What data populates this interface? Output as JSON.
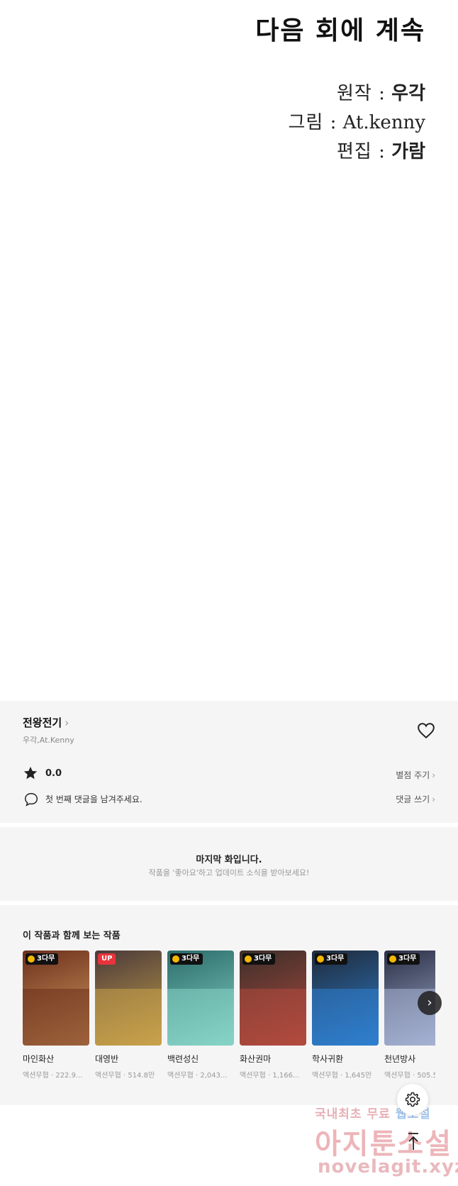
{
  "panel": {
    "next_text": "다음 회에 계속",
    "credits": [
      {
        "label": "원작 :",
        "value": "우각"
      },
      {
        "label": "그림 :",
        "value": "At.kenny"
      },
      {
        "label": "편집 :",
        "value": "가람"
      }
    ]
  },
  "episode": {
    "series_title": "전왕전기",
    "authors": "우각,At.Kenny",
    "rating": "0.0",
    "rate_link": "별점 주기",
    "comment_prompt": "첫 번째 댓글을 남겨주세요.",
    "comment_link": "댓글 쓰기"
  },
  "notice": {
    "title": "마지막 화입니다.",
    "subtitle": "작품을 '좋아요'하고 업데이트 소식을 받아보세요!"
  },
  "recommendations": {
    "title": "이 작품과 함께 보는 작품",
    "items": [
      {
        "title": "마인화산",
        "meta": "액션무협 · 222.9...",
        "badge": "3다무",
        "color": "#6b2f1c",
        "color2": "#d9a062"
      },
      {
        "title": "대영반",
        "meta": "액션무협 · 514.8만",
        "badge": "UP",
        "color": "#4a3a3a",
        "color2": "#c9a24a"
      },
      {
        "title": "백련성신",
        "meta": "액션무협 · 2,043...",
        "badge": "3다무",
        "color": "#2b6b6a",
        "color2": "#86d4c7"
      },
      {
        "title": "화산권마",
        "meta": "액션무협 · 1,166...",
        "badge": "3다무",
        "color": "#3c2f2a",
        "color2": "#b34a3e"
      },
      {
        "title": "학사귀환",
        "meta": "액션무협 · 1,645만",
        "badge": "3다무",
        "color": "#1f2a3a",
        "color2": "#2f7fcf"
      },
      {
        "title": "천년방사",
        "meta": "액션무협 · 505.5",
        "badge": "3다무",
        "color": "#2a2f45",
        "color2": "#a7b4d6"
      }
    ]
  },
  "watermark": {
    "line1_a": "국내최초 무료",
    "line1_b": "웹소설",
    "line2": "아지툰소설",
    "line3": "novelagit.xyz"
  }
}
